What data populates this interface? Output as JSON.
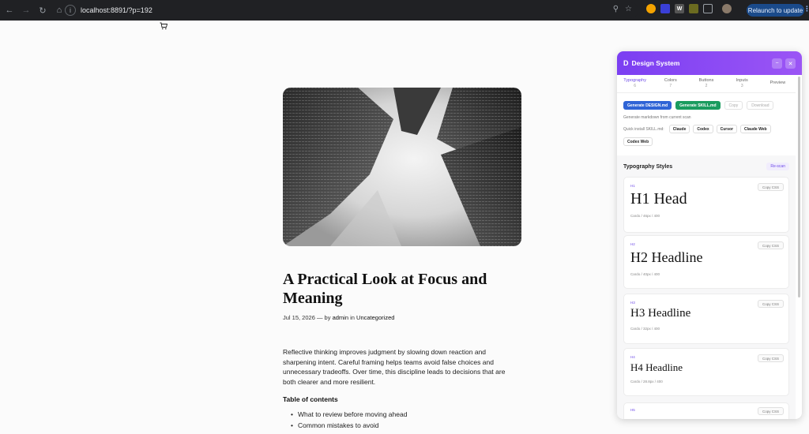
{
  "browser": {
    "url": "localhost:8891/?p=192",
    "relaunch_label": "Relaunch to update",
    "extensions": [
      "W"
    ]
  },
  "post": {
    "title": "A Practical Look at Focus and Meaning",
    "date": "Jul 15, 2026",
    "byline_sep": "— by",
    "author": "admin",
    "in_word": "in",
    "category": "Uncategorized",
    "body": "Reflective thinking improves judgment by slowing down reaction and sharpening intent. Careful framing helps teams avoid false choices and unnecessary tradeoffs. Over time, this discipline leads to decisions that are both clearer and more resilient.",
    "toc_heading": "Table of contents",
    "toc_items": [
      "What to review before moving ahead",
      "Common mistakes to avoid"
    ]
  },
  "panel": {
    "logo": "D",
    "title": "Design System",
    "tabs": [
      {
        "label": "Typography",
        "count": "6"
      },
      {
        "label": "Colors",
        "count": "7"
      },
      {
        "label": "Buttons",
        "count": "2"
      },
      {
        "label": "Inputs",
        "count": "3"
      },
      {
        "label": "Preview",
        "count": ""
      }
    ],
    "actions": {
      "gen_design": "Generate DESIGN.md",
      "gen_skill": "Generate SKILL.md",
      "copy": "Copy",
      "download": "Download"
    },
    "gen_note": "Generate markdown from current scan",
    "quick_label": "Quick install SKILL.md:",
    "quick_buttons": [
      "Claude",
      "Codex",
      "Cursor",
      "Claude Web"
    ],
    "codex_web": "Codex Web",
    "section_title": "Typography Styles",
    "rescan": "Re-scan",
    "copy_css": "Copy CSS",
    "cards": [
      {
        "tag": "H1",
        "sample": "H1 Head",
        "spec": "Cardo / 46px / 400"
      },
      {
        "tag": "H2",
        "sample": "H2 Headline",
        "spec": "Cardo / 40px / 400"
      },
      {
        "tag": "H3",
        "sample": "H3 Headline",
        "spec": "Cardo / 32px / 400"
      },
      {
        "tag": "H4",
        "sample": "H4 Headline",
        "spec": "Cardo / 28.8px / 400"
      },
      {
        "tag": "H5",
        "sample": "",
        "spec": ""
      }
    ]
  }
}
